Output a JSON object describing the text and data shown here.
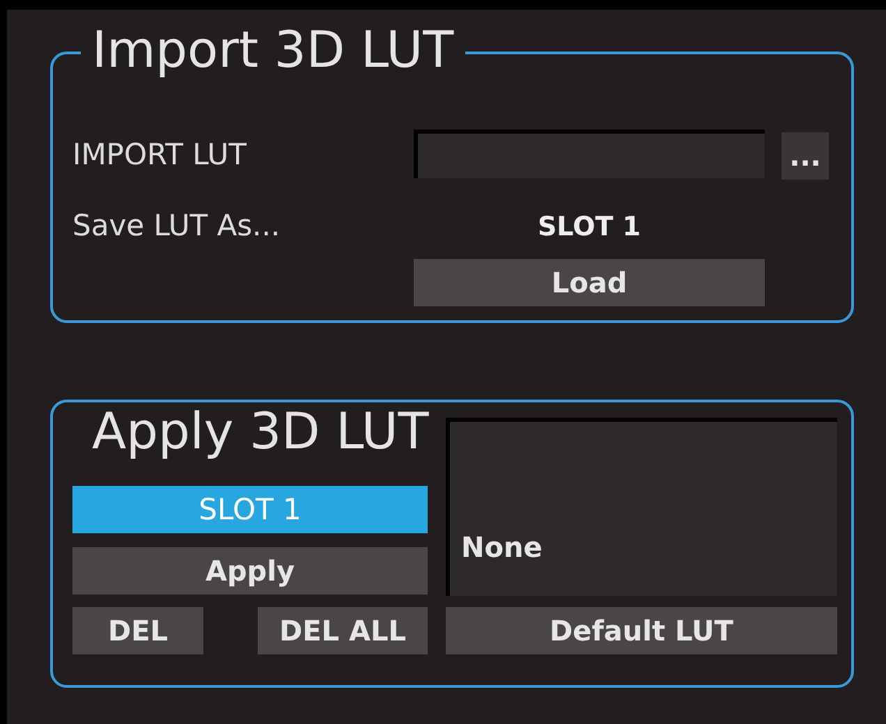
{
  "import_panel": {
    "title": "Import 3D LUT",
    "import_label": "IMPORT LUT",
    "browse_button": "...",
    "save_label": "Save LUT As...",
    "slot_value": "SLOT 1",
    "load_button": "Load"
  },
  "apply_panel": {
    "title": "Apply 3D LUT",
    "slots": [
      {
        "label": "SLOT 1",
        "selected": true
      }
    ],
    "apply_button": "Apply",
    "del_button": "DEL",
    "del_all_button": "DEL ALL",
    "lut_display": "None",
    "default_button": "Default LUT"
  }
}
